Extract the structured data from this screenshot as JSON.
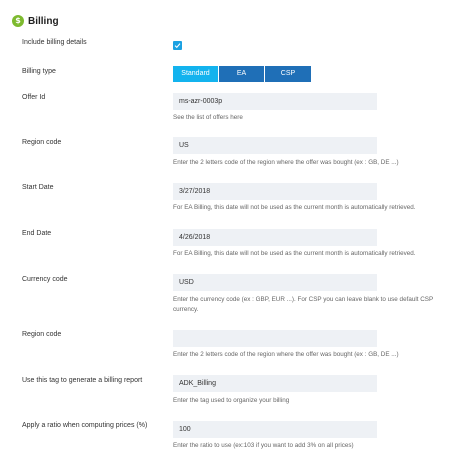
{
  "header": {
    "title": "Billing",
    "icon": "dollar-circle-icon",
    "icon_color": "#7dba2f"
  },
  "include_billing": {
    "label": "Include billing details",
    "checked": true
  },
  "billing_type": {
    "label": "Billing type",
    "options": [
      "Standard",
      "EA",
      "CSP"
    ],
    "selected": "Standard"
  },
  "offer_id": {
    "label": "Offer Id",
    "value": "ms-azr-0003p",
    "help_prefix": "See the list of offers ",
    "help_link": "here"
  },
  "region_code": {
    "label": "Region code",
    "value": "US",
    "help": "Enter the 2 letters code of the region where the offer was bought (ex : GB, DE ...)"
  },
  "start_date": {
    "label": "Start Date",
    "value": "3/27/2018",
    "help": "For EA Billing, this date will not be used as the current month is automatically retrieved."
  },
  "end_date": {
    "label": "End Date",
    "value": "4/26/2018",
    "help": "For EA Billing, this date will not be used as the current month is automatically retrieved."
  },
  "currency_code": {
    "label": "Currency code",
    "value": "USD",
    "help_line1": "Enter the currency code (ex : GBP, EUR ...). For CSP you can leave blank to use default CSP",
    "help_line2": "currency."
  },
  "region_code_2": {
    "label": "Region code",
    "value": "",
    "help": "Enter the 2 letters code of the region where the offer was bought (ex : GB, DE ...)"
  },
  "billing_tag": {
    "label": "Use this tag to generate a billing report",
    "value": "ADK_Billing",
    "help": "Enter the tag used to organize your billing"
  },
  "ratio": {
    "label": "Apply a ratio when computing prices (%)",
    "value": "100",
    "help": "Enter the ratio to use (ex:103 if you want to add 3% on all prices)"
  },
  "colors": {
    "accent": "#13b3ee",
    "segment": "#1f6fb7",
    "checkbox": "#1ba1e2",
    "input_bg": "#eef1f5"
  }
}
